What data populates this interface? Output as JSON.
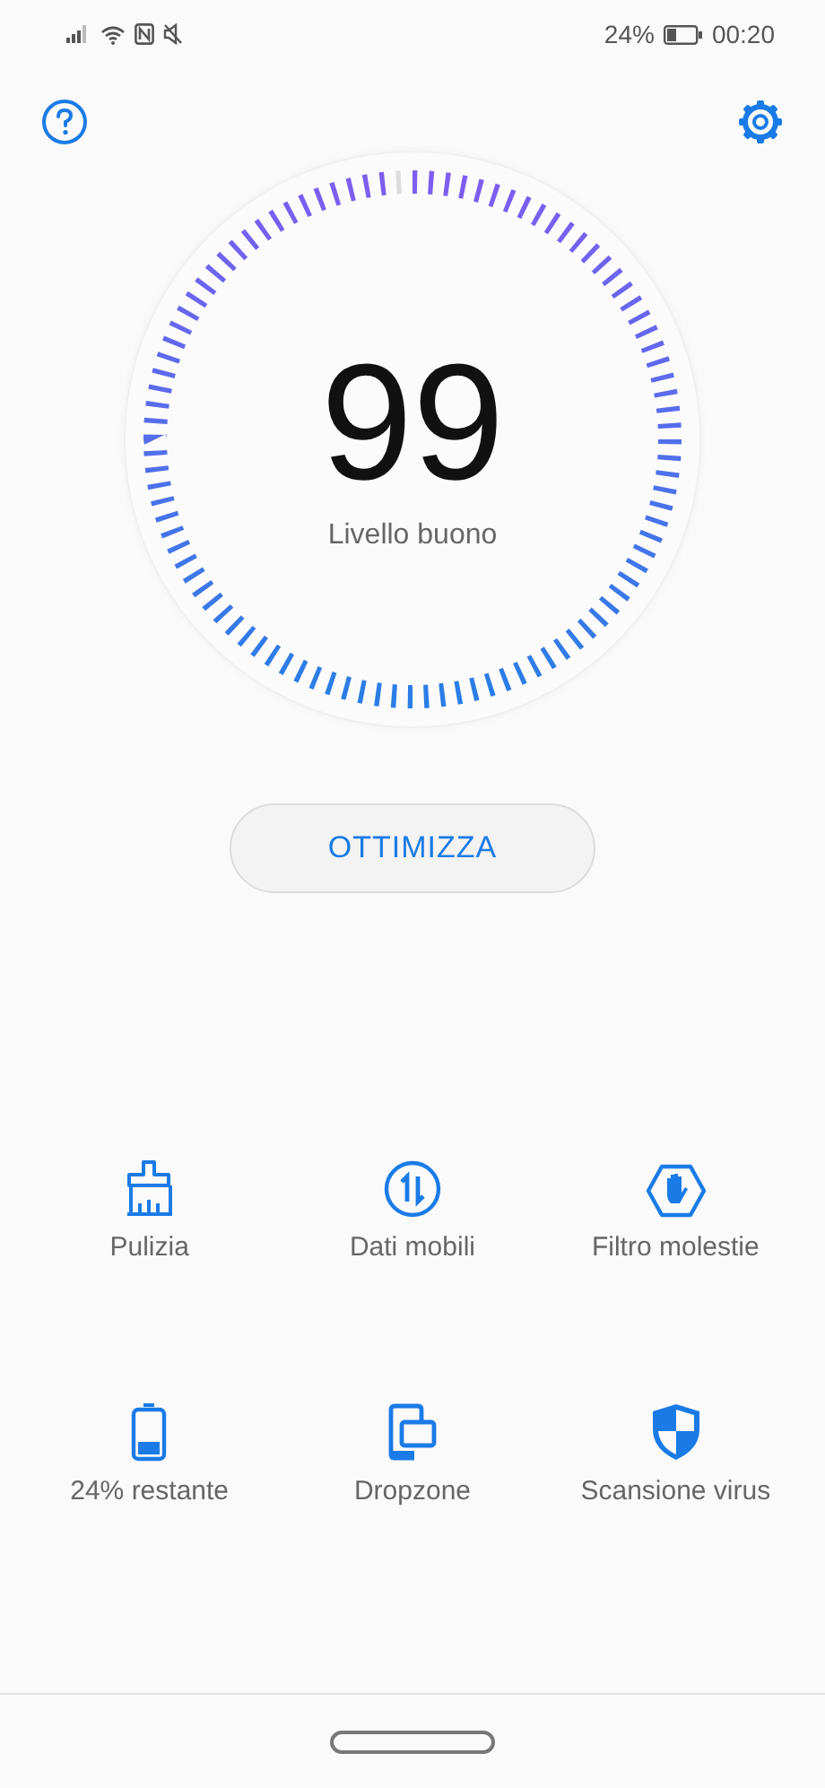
{
  "status_bar": {
    "battery": "24%",
    "time": "00:20"
  },
  "gauge": {
    "score": "99",
    "level": 0.99,
    "caption": "Livello buono"
  },
  "optimize_button": "OTTIMIZZA",
  "tools": [
    {
      "kind": "broom",
      "label": "Pulizia"
    },
    {
      "kind": "data",
      "label": "Dati mobili"
    },
    {
      "kind": "block",
      "label": "Filtro molestie"
    },
    {
      "kind": "battery",
      "label": "24% restante"
    },
    {
      "kind": "dropzone",
      "label": "Dropzone"
    },
    {
      "kind": "shield",
      "label": "Scansione virus"
    }
  ]
}
